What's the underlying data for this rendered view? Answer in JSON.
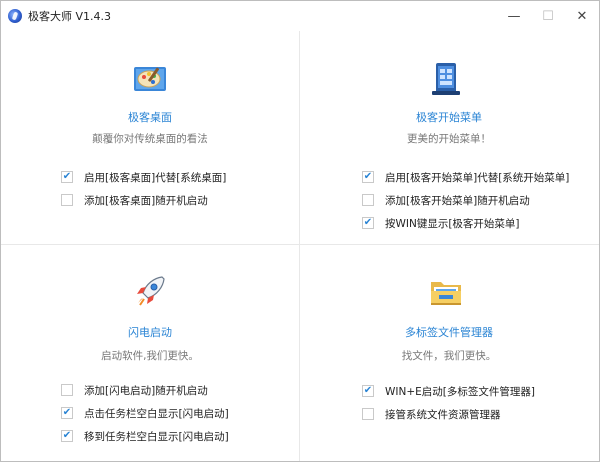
{
  "window": {
    "title": "极客大师 V1.4.3",
    "controls": {
      "minimize": "—",
      "maximize": "☐",
      "close": "✕"
    }
  },
  "panels": {
    "desktop": {
      "icon": "palette-icon",
      "title": "极客桌面",
      "subtitle": "颠覆你对传统桌面的看法",
      "options": [
        {
          "label": "启用[极客桌面]代替[系统桌面]",
          "checked": true
        },
        {
          "label": "添加[极客桌面]随开机启动",
          "checked": false
        }
      ]
    },
    "start_menu": {
      "icon": "start-menu-icon",
      "title": "极客开始菜单",
      "subtitle": "更美的开始菜单！",
      "options": [
        {
          "label": "启用[极客开始菜单]代替[系统开始菜单]",
          "checked": true
        },
        {
          "label": "添加[极客开始菜单]随开机启动",
          "checked": false
        },
        {
          "label": "按WIN键显示[极客开始菜单]",
          "checked": true
        }
      ]
    },
    "launcher": {
      "icon": "rocket-icon",
      "title": "闪电启动",
      "subtitle": "启动软件,我们更快。",
      "options": [
        {
          "label": "添加[闪电启动]随开机启动",
          "checked": false
        },
        {
          "label": "点击任务栏空白显示[闪电启动]",
          "checked": true
        },
        {
          "label": "移到任务栏空白显示[闪电启动]",
          "checked": true
        }
      ]
    },
    "file_manager": {
      "icon": "folder-icon",
      "title": "多标签文件管理器",
      "subtitle": "找文件，我们更快。",
      "options": [
        {
          "label": "WIN+E启动[多标签文件管理器]",
          "checked": true
        },
        {
          "label": "接管系统文件资源管理器",
          "checked": false
        }
      ]
    }
  },
  "colors": {
    "accent": "#2a84d4",
    "subtitle": "#777777",
    "divider": "#e8e8e8"
  }
}
